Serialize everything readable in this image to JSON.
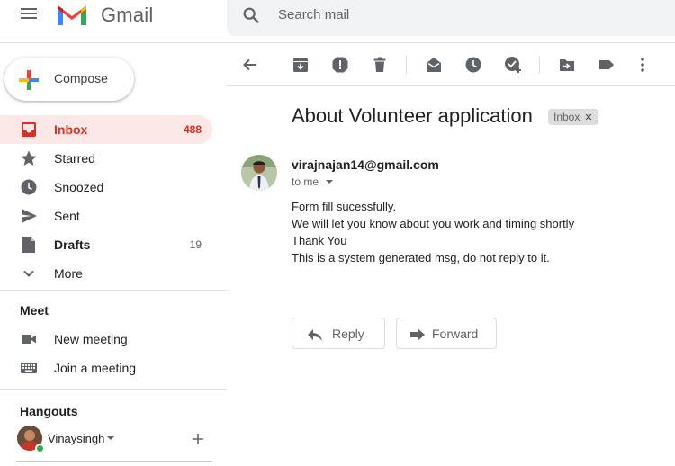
{
  "app": {
    "name": "Gmail"
  },
  "search": {
    "placeholder": "Search mail"
  },
  "compose": {
    "label": "Compose"
  },
  "nav": [
    {
      "label": "Inbox",
      "count": "488"
    },
    {
      "label": "Starred",
      "count": ""
    },
    {
      "label": "Snoozed",
      "count": ""
    },
    {
      "label": "Sent",
      "count": ""
    },
    {
      "label": "Drafts",
      "count": "19"
    },
    {
      "label": "More",
      "count": ""
    }
  ],
  "meet": {
    "title": "Meet",
    "items": [
      {
        "label": "New meeting"
      },
      {
        "label": "Join a meeting"
      }
    ]
  },
  "hangouts": {
    "title": "Hangouts",
    "user": "Vinaysingh"
  },
  "message": {
    "subject": "About Volunteer application",
    "label": "Inbox",
    "sender": "virajnajan14@gmail.com",
    "to": "to me",
    "body": [
      "Form fill sucessfully.",
      "We will let you know about you work and timing shortly",
      "Thank You",
      "This is a system generated msg, do not reply to it."
    ],
    "reply_label": "Reply",
    "forward_label": "Forward"
  },
  "colors": {
    "accent": "#d93025",
    "active_bg": "#fce8e6",
    "icon": "#5f6368"
  }
}
